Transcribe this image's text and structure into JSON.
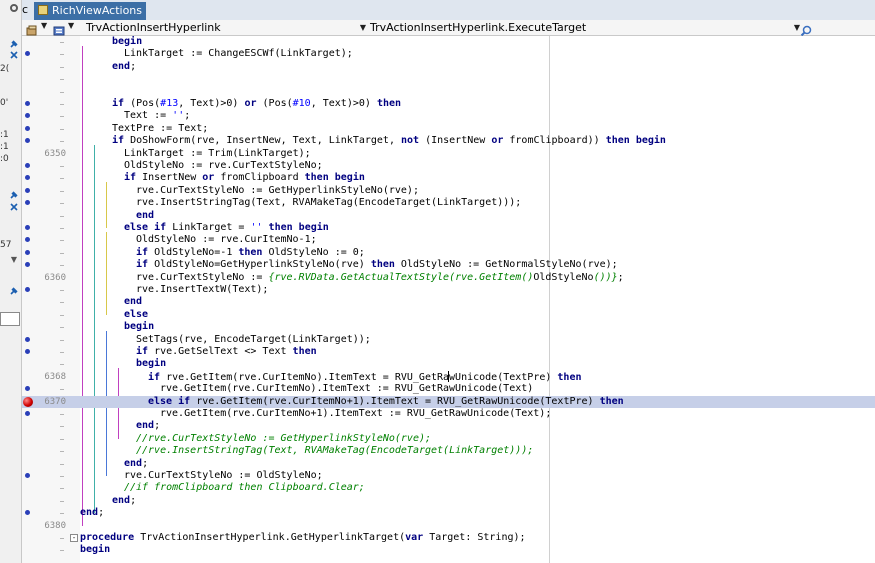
{
  "window": {
    "tab_prefix": "c",
    "tab_label": "RichViewActions"
  },
  "left_panel": {
    "digits": [
      "2(",
      "0'",
      ":1",
      ":1",
      ":0",
      "57"
    ]
  },
  "navbar": {
    "class_combo": "TrvActionInsertHyperlink",
    "method_combo": "TrvActionInsertHyperlink.ExecuteTarget"
  },
  "editor": {
    "current_line_number": 6370,
    "lines": [
      {
        "num": "",
        "bp": false,
        "exec": false,
        "fold": "",
        "indent": 2,
        "segs": [
          [
            "kw",
            "begin"
          ]
        ]
      },
      {
        "num": "",
        "bp": true,
        "exec": false,
        "fold": "",
        "indent": 3,
        "segs": [
          [
            "t",
            "LinkTarget := ChangeESCWf(LinkTarget);"
          ]
        ]
      },
      {
        "num": "",
        "bp": false,
        "exec": false,
        "fold": "",
        "indent": 2,
        "segs": [
          [
            "kw",
            "end"
          ],
          [
            "t",
            ";"
          ]
        ]
      },
      {
        "num": "",
        "bp": false,
        "exec": false,
        "fold": "",
        "indent": 0,
        "segs": []
      },
      {
        "num": "",
        "bp": false,
        "exec": false,
        "fold": "",
        "indent": 0,
        "segs": []
      },
      {
        "num": "",
        "bp": true,
        "exec": false,
        "fold": "",
        "indent": 2,
        "segs": [
          [
            "kw",
            "if"
          ],
          [
            "t",
            " (Pos("
          ],
          [
            "str",
            "#13"
          ],
          [
            "t",
            ", Text)>0) "
          ],
          [
            "kw",
            "or"
          ],
          [
            "t",
            " (Pos("
          ],
          [
            "str",
            "#10"
          ],
          [
            "t",
            ", Text)>0) "
          ],
          [
            "kw",
            "then"
          ]
        ]
      },
      {
        "num": "",
        "bp": true,
        "exec": false,
        "fold": "",
        "indent": 3,
        "segs": [
          [
            "t",
            "Text := "
          ],
          [
            "str",
            "''"
          ],
          [
            "t",
            ";"
          ]
        ]
      },
      {
        "num": "",
        "bp": true,
        "exec": false,
        "fold": "",
        "indent": 2,
        "segs": [
          [
            "t",
            "TextPre := Text;"
          ]
        ]
      },
      {
        "num": "",
        "bp": true,
        "exec": false,
        "fold": "",
        "indent": 2,
        "segs": [
          [
            "kw",
            "if"
          ],
          [
            "t",
            " DoShowForm(rve, InsertNew, Text, LinkTarget, "
          ],
          [
            "kw",
            "not"
          ],
          [
            "t",
            " (InsertNew "
          ],
          [
            "kw",
            "or"
          ],
          [
            "t",
            " fromClipboard)) "
          ],
          [
            "kw",
            "then"
          ],
          [
            "t",
            " "
          ],
          [
            "kw",
            "begin"
          ]
        ]
      },
      {
        "num": "6350",
        "bp": false,
        "exec": false,
        "fold": "",
        "indent": 3,
        "segs": [
          [
            "t",
            "LinkTarget := Trim(LinkTarget);"
          ]
        ]
      },
      {
        "num": "",
        "bp": true,
        "exec": false,
        "fold": "",
        "indent": 3,
        "segs": [
          [
            "t",
            "OldStyleNo := rve.CurTextStyleNo;"
          ]
        ]
      },
      {
        "num": "",
        "bp": true,
        "exec": false,
        "fold": "",
        "indent": 3,
        "segs": [
          [
            "kw",
            "if"
          ],
          [
            "t",
            " InsertNew "
          ],
          [
            "kw",
            "or"
          ],
          [
            "t",
            " fromClipboard "
          ],
          [
            "kw",
            "then"
          ],
          [
            "t",
            " "
          ],
          [
            "kw",
            "begin"
          ]
        ]
      },
      {
        "num": "",
        "bp": true,
        "exec": false,
        "fold": "",
        "indent": 4,
        "segs": [
          [
            "t",
            "rve.CurTextStyleNo := GetHyperlinkStyleNo(rve);"
          ]
        ]
      },
      {
        "num": "",
        "bp": true,
        "exec": false,
        "fold": "",
        "indent": 4,
        "segs": [
          [
            "t",
            "rve.InsertStringTag(Text, RVAMakeTag(EncodeTarget(LinkTarget)));"
          ]
        ]
      },
      {
        "num": "",
        "bp": false,
        "exec": false,
        "fold": "",
        "indent": 4,
        "segs": [
          [
            "kw",
            "end"
          ]
        ]
      },
      {
        "num": "",
        "bp": true,
        "exec": false,
        "fold": "",
        "indent": 3,
        "segs": [
          [
            "kw",
            "else"
          ],
          [
            "t",
            " "
          ],
          [
            "kw",
            "if"
          ],
          [
            "t",
            " LinkTarget = "
          ],
          [
            "str",
            "''"
          ],
          [
            "t",
            " "
          ],
          [
            "kw",
            "then"
          ],
          [
            "t",
            " "
          ],
          [
            "kw",
            "begin"
          ]
        ]
      },
      {
        "num": "",
        "bp": true,
        "exec": false,
        "fold": "",
        "indent": 4,
        "segs": [
          [
            "t",
            "OldStyleNo := rve.CurItemNo-1;"
          ]
        ]
      },
      {
        "num": "",
        "bp": true,
        "exec": false,
        "fold": "",
        "indent": 4,
        "segs": [
          [
            "kw",
            "if"
          ],
          [
            "t",
            " OldStyleNo=-1 "
          ],
          [
            "kw",
            "then"
          ],
          [
            "t",
            " OldStyleNo := 0;"
          ]
        ]
      },
      {
        "num": "",
        "bp": true,
        "exec": false,
        "fold": "",
        "indent": 4,
        "segs": [
          [
            "kw",
            "if"
          ],
          [
            "t",
            " OldStyleNo=GetHyperlinkStyleNo(rve) "
          ],
          [
            "kw",
            "then"
          ],
          [
            "t",
            " OldStyleNo := GetNormalStyleNo(rve);"
          ]
        ]
      },
      {
        "num": "6360",
        "bp": false,
        "exec": false,
        "fold": "",
        "indent": 4,
        "segs": [
          [
            "t",
            "rve.CurTextStyleNo := "
          ],
          [
            "cm",
            "{rve.RVData.GetActualTextStyle(rve.GetItem()"
          ],
          [
            "t",
            "OldStyleNo"
          ],
          [
            "cm",
            "())}"
          ],
          [
            "t",
            ";"
          ]
        ]
      },
      {
        "num": "",
        "bp": true,
        "exec": false,
        "fold": "",
        "indent": 4,
        "segs": [
          [
            "t",
            "rve.InsertTextW(Text);"
          ]
        ]
      },
      {
        "num": "",
        "bp": false,
        "exec": false,
        "fold": "",
        "indent": 3,
        "segs": [
          [
            "kw",
            "end"
          ]
        ]
      },
      {
        "num": "",
        "bp": false,
        "exec": false,
        "fold": "",
        "indent": 3,
        "segs": [
          [
            "kw",
            "else"
          ]
        ]
      },
      {
        "num": "",
        "bp": false,
        "exec": false,
        "fold": "",
        "indent": 3,
        "segs": [
          [
            "kw",
            "begin"
          ]
        ]
      },
      {
        "num": "",
        "bp": true,
        "exec": false,
        "fold": "",
        "indent": 4,
        "segs": [
          [
            "t",
            "SetTags(rve, EncodeTarget(LinkTarget));"
          ]
        ]
      },
      {
        "num": "",
        "bp": true,
        "exec": false,
        "fold": "",
        "indent": 4,
        "segs": [
          [
            "kw",
            "if"
          ],
          [
            "t",
            " rve.GetSelText <> Text "
          ],
          [
            "kw",
            "then"
          ]
        ]
      },
      {
        "num": "",
        "bp": false,
        "exec": false,
        "fold": "",
        "indent": 4,
        "segs": [
          [
            "kw",
            "begin"
          ]
        ]
      },
      {
        "num": "6368",
        "bp": false,
        "exec": false,
        "fold": "",
        "indent": 5,
        "segs": [
          [
            "kw",
            "if"
          ],
          [
            "t",
            " rve.GetItem(rve.CurItemNo).ItemText = RVU_GetRa"
          ],
          [
            "cursor",
            ""
          ],
          [
            "t",
            "wUnicode(TextPre) "
          ],
          [
            "kw",
            "then"
          ]
        ]
      },
      {
        "num": "",
        "bp": true,
        "exec": false,
        "fold": "",
        "indent": 6,
        "segs": [
          [
            "t",
            "rve.GetItem(rve.CurItemNo).ItemText := RVU_GetRawUnicode(Text)"
          ]
        ]
      },
      {
        "num": "6370",
        "bp": "red",
        "exec": true,
        "fold": "",
        "indent": 5,
        "segs": [
          [
            "kw",
            "else"
          ],
          [
            "t",
            " "
          ],
          [
            "kw",
            "if"
          ],
          [
            "t",
            " rve.GetItem(rve.CurItemNo+1).ItemText = RVU_GetRawUnicode(TextPre) "
          ],
          [
            "kw",
            "then"
          ]
        ]
      },
      {
        "num": "",
        "bp": true,
        "exec": false,
        "fold": "",
        "indent": 6,
        "segs": [
          [
            "t",
            "rve.GetItem(rve.CurItemNo+1).ItemText := RVU_GetRawUnicode(Text);"
          ]
        ]
      },
      {
        "num": "",
        "bp": false,
        "exec": false,
        "fold": "",
        "indent": 4,
        "segs": [
          [
            "kw",
            "end"
          ],
          [
            "t",
            ";"
          ]
        ]
      },
      {
        "num": "",
        "bp": false,
        "exec": false,
        "fold": "",
        "indent": 4,
        "segs": [
          [
            "cm",
            "//rve.CurTextStyleNo := GetHyperlinkStyleNo(rve);"
          ]
        ]
      },
      {
        "num": "",
        "bp": false,
        "exec": false,
        "fold": "",
        "indent": 4,
        "segs": [
          [
            "cm",
            "//rve.InsertStringTag(Text, RVAMakeTag(EncodeTarget(LinkTarget)));"
          ]
        ]
      },
      {
        "num": "",
        "bp": false,
        "exec": false,
        "fold": "",
        "indent": 3,
        "segs": [
          [
            "kw",
            "end"
          ],
          [
            "t",
            ";"
          ]
        ]
      },
      {
        "num": "",
        "bp": true,
        "exec": false,
        "fold": "",
        "indent": 3,
        "segs": [
          [
            "t",
            "rve.CurTextStyleNo := OldStyleNo;"
          ]
        ]
      },
      {
        "num": "",
        "bp": false,
        "exec": false,
        "fold": "",
        "indent": 3,
        "segs": [
          [
            "cm",
            "//if fromClipboard then Clipboard.Clear;"
          ]
        ]
      },
      {
        "num": "",
        "bp": false,
        "exec": false,
        "fold": "",
        "indent": 2,
        "segs": [
          [
            "kw",
            "end"
          ],
          [
            "t",
            ";"
          ]
        ]
      },
      {
        "num": "",
        "bp": true,
        "exec": false,
        "fold": "",
        "indent": 0,
        "segs": [
          [
            "kw",
            "end"
          ],
          [
            "t",
            ";"
          ]
        ]
      },
      {
        "num": "6380",
        "bp": false,
        "exec": false,
        "fold": "",
        "indent": 0,
        "segs": []
      },
      {
        "num": "",
        "bp": false,
        "exec": false,
        "fold": "-",
        "indent": 0,
        "segs": [
          [
            "kw",
            "procedure"
          ],
          [
            "t",
            " TrvActionInsertHyperlink.GetHyperlinkTarget("
          ],
          [
            "kw",
            "var"
          ],
          [
            "t",
            " Target: String);"
          ]
        ]
      },
      {
        "num": "",
        "bp": false,
        "exec": false,
        "fold": "",
        "indent": 0,
        "segs": [
          [
            "kw",
            "begin"
          ]
        ]
      }
    ]
  }
}
